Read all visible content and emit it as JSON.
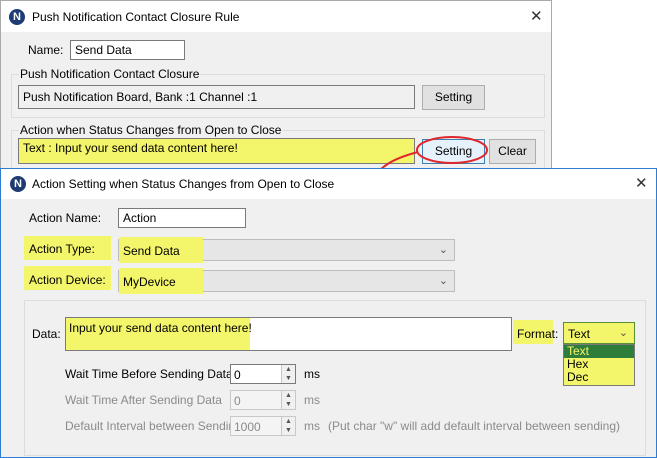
{
  "rule_window": {
    "title": "Push Notification Contact Closure Rule",
    "name_label": "Name:",
    "name_value": "Send Data",
    "group1_title": "Push Notification Contact Closure",
    "group1_value": "Push Notification Board, Bank :1 Channel :1",
    "setting_button": "Setting",
    "group2_title": "Action when Status Changes from Open to Close",
    "group2_value": "Text : Input your send data content here!",
    "setting_button2": "Setting",
    "clear_button": "Clear"
  },
  "action_window": {
    "title": "Action Setting when Status Changes from Open to Close",
    "action_name_label": "Action Name:",
    "action_name_value": "Action",
    "action_type_label": "Action Type:",
    "action_type_value": "Send Data",
    "action_device_label": "Action Device:",
    "action_device_value": "MyDevice",
    "data_label": "Data:",
    "data_value": "Input your send data content here!",
    "format_label": "Format:",
    "format_value": "Text",
    "format_options": [
      "Text",
      "Hex",
      "Dec"
    ],
    "wait_before_label": "Wait Time Before Sending Data",
    "wait_before_value": "0",
    "wait_after_label": "Wait Time After Sending Data",
    "wait_after_value": "0",
    "default_interval_label": "Default Interval between Sending",
    "default_interval_value": "1000",
    "ms_unit": "ms",
    "interval_note": "(Put char \"w\" will add default interval between sending)"
  },
  "colors": {
    "highlight": "#f3f56a",
    "annotation_red": "#e0262b",
    "window_bg": "#f0f0f0",
    "active_border": "#2f7dd1"
  }
}
